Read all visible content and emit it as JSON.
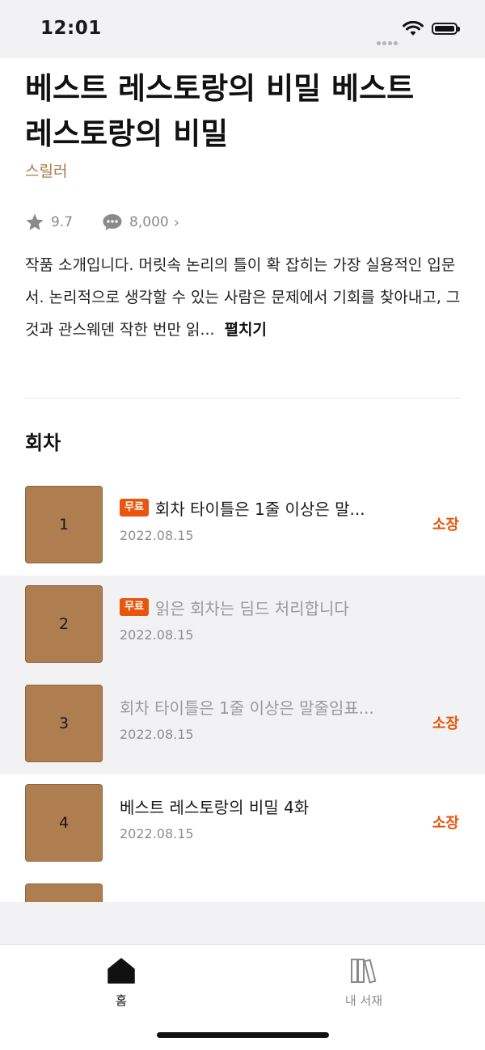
{
  "status_bar": {
    "time": "12:01"
  },
  "work": {
    "title": "베스트 레스토랑의 비밀 베스트 레스토랑의 비밀",
    "genre": "스릴러",
    "rating": "9.7",
    "comments": "8,000",
    "description": "작품 소개입니다. 머릿속 논리의 틀이 확 잡히는 가장 실용적인 입문서. 논리적으로 생각할 수 있는 사람은 문제에서 기회를 찾아내고, 그것과 관스웨덴 작한 번만 읽...",
    "more_label": "펼치기"
  },
  "episodes_section": {
    "title": "회차",
    "items": [
      {
        "number": "1",
        "badge": "무료",
        "title": "회차 타이틀은 1줄 이상은 말...",
        "date": "2022.08.15",
        "owned": "소장"
      },
      {
        "number": "2",
        "badge": "무료",
        "title": "읽은 회차는 딤드 처리합니다",
        "date": "2022.08.15",
        "owned": ""
      },
      {
        "number": "3",
        "badge": "",
        "title": "회차 타이틀은 1줄 이상은 말줄임표...",
        "date": "2022.08.15",
        "owned": "소장"
      },
      {
        "number": "4",
        "badge": "",
        "title": "베스트 레스토랑의 비밀 4화",
        "date": "2022.08.15",
        "owned": "소장"
      }
    ]
  },
  "tabs": {
    "home": "홈",
    "library": "내 서재"
  },
  "colors": {
    "accent": "#e8550b",
    "genre": "#b07a44",
    "thumbnail": "#ae7d50"
  }
}
